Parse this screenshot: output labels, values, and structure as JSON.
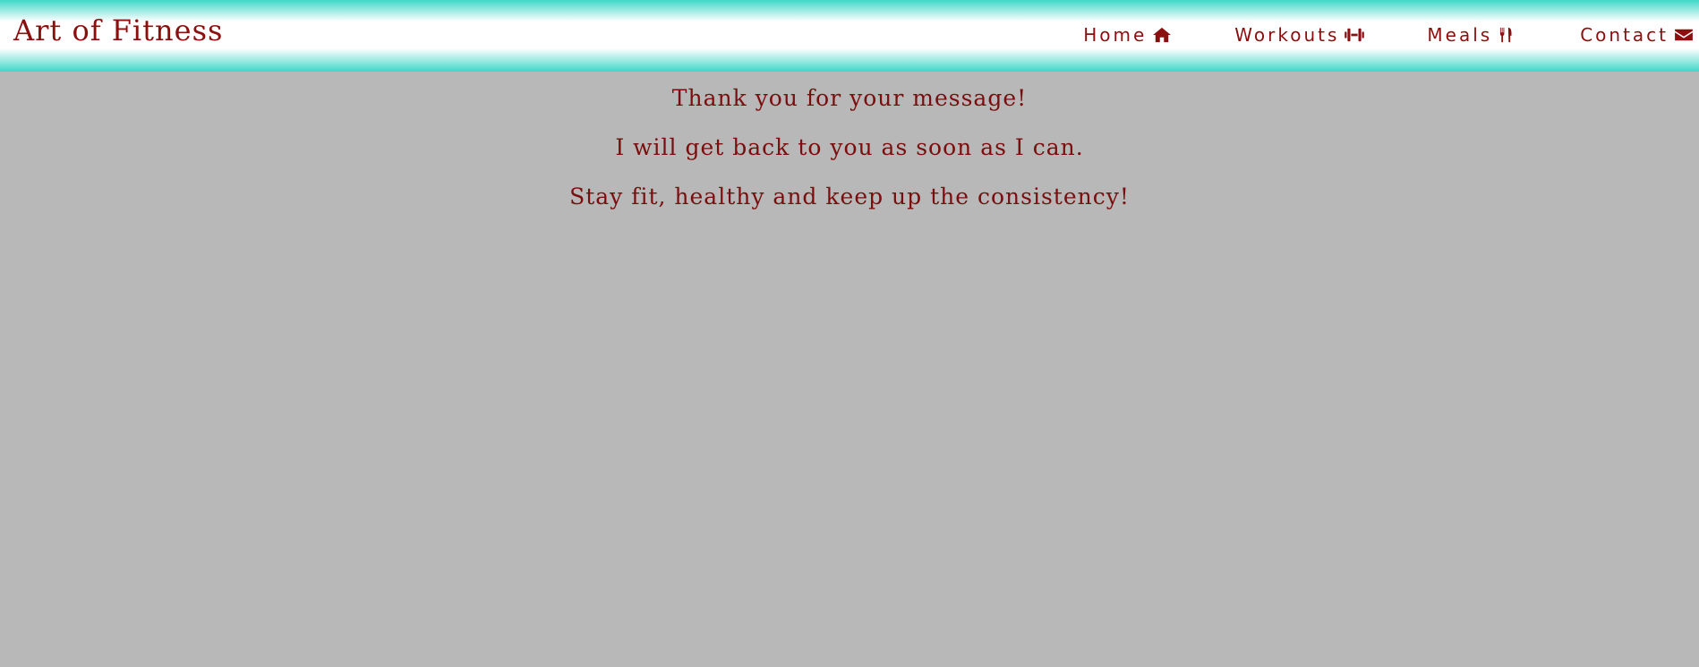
{
  "header": {
    "brand": "Art of Fitness",
    "nav": [
      {
        "label": "Home",
        "icon": "home-icon"
      },
      {
        "label": "Workouts",
        "icon": "dumbbell-icon"
      },
      {
        "label": "Meals",
        "icon": "utensils-icon"
      },
      {
        "label": "Contact",
        "icon": "envelope-icon"
      }
    ]
  },
  "main": {
    "lines": [
      "Thank you for your message!",
      "I will get back to you as soon as I can.",
      "Stay fit, healthy and keep up the consistency!"
    ]
  },
  "colors": {
    "accent": "#8b0f0f",
    "header_gradient": "#3fd7c8",
    "background": "#b8b8b8"
  }
}
